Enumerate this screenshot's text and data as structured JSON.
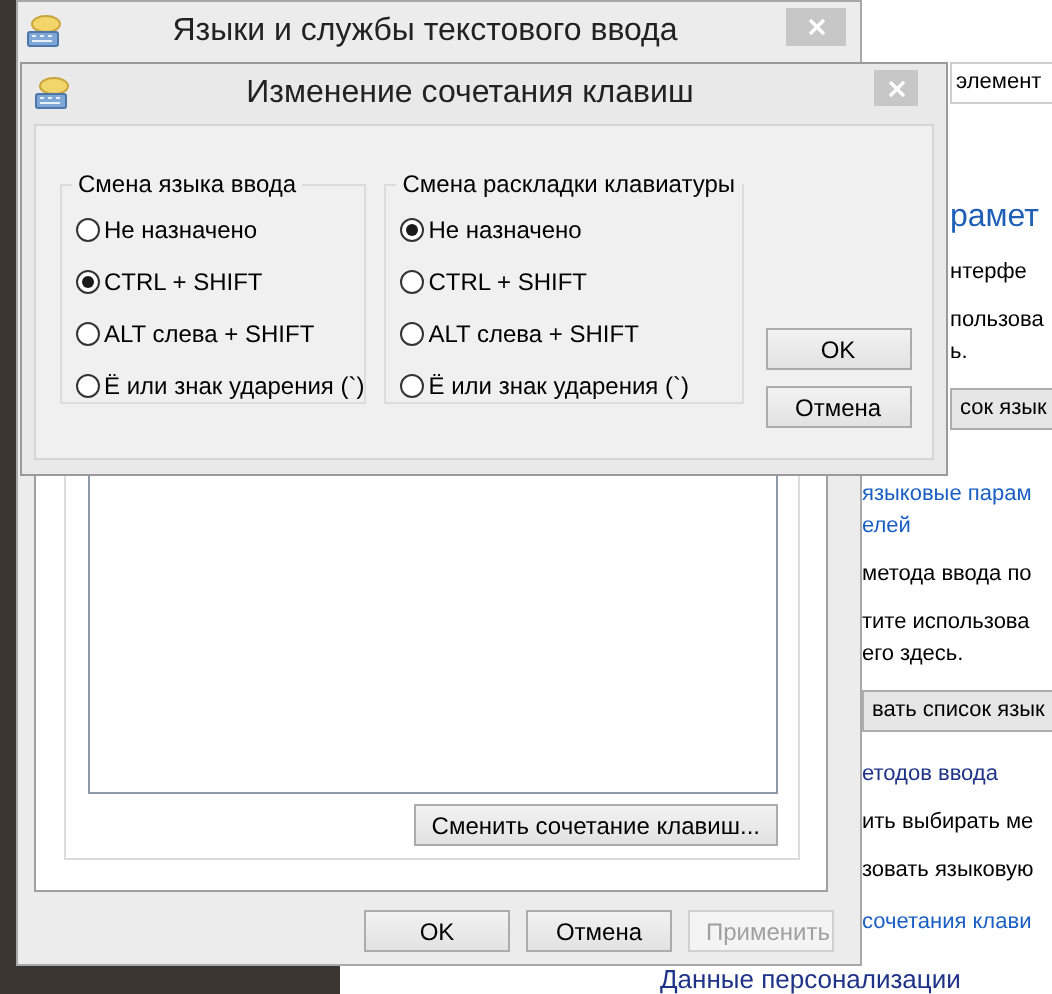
{
  "background": {
    "upper_items": [
      {
        "kind": "field",
        "lines": [
          "элемент"
        ]
      },
      {
        "kind": "heading",
        "lines": [
          "рамет"
        ]
      },
      {
        "kind": "text",
        "lines": [
          "нтерфе"
        ]
      },
      {
        "kind": "text",
        "lines": [
          "пользова",
          "ь."
        ]
      },
      {
        "kind": "button",
        "lines": [
          "сок язык"
        ]
      }
    ],
    "items": [
      {
        "kind": "link",
        "lines": [
          "языковые парам",
          "елей"
        ]
      },
      {
        "kind": "text",
        "lines": [
          "метода ввода по"
        ]
      },
      {
        "kind": "text",
        "lines": [
          "тите использова",
          "его здесь."
        ]
      },
      {
        "kind": "button",
        "lines": [
          "вать список язык"
        ]
      },
      {
        "kind": "section",
        "lines": [
          "етодов ввода"
        ]
      },
      {
        "kind": "text",
        "lines": [
          "ить выбирать ме"
        ]
      },
      {
        "kind": "text",
        "lines": [
          "зовать языковую"
        ]
      },
      {
        "kind": "link",
        "lines": [
          "сочетания клави"
        ]
      },
      {
        "kind": "footer",
        "lines": [
          "Данные персонализации"
        ]
      }
    ]
  },
  "main_window": {
    "title": "Языки и службы текстового ввода",
    "shortcut_button": "Сменить сочетание клавиш...",
    "buttons": [
      {
        "label": "OK",
        "disabled": false
      },
      {
        "label": "Отмена",
        "disabled": false
      },
      {
        "label": "Применить",
        "disabled": true
      }
    ]
  },
  "dialog": {
    "title": "Изменение сочетания клавиш",
    "groups": [
      {
        "title": "Смена языка ввода",
        "options": [
          {
            "label": "Не назначено",
            "selected": false
          },
          {
            "label": "CTRL + SHIFT",
            "selected": true
          },
          {
            "label": "ALT слева + SHIFT",
            "selected": false
          },
          {
            "label": "Ё или знак ударения (`)",
            "selected": false
          }
        ]
      },
      {
        "title": "Смена раскладки клавиатуры",
        "options": [
          {
            "label": "Не назначено",
            "selected": true
          },
          {
            "label": "CTRL + SHIFT",
            "selected": false
          },
          {
            "label": "ALT слева + SHIFT",
            "selected": false
          },
          {
            "label": "Ё или знак ударения (`)",
            "selected": false
          }
        ]
      }
    ],
    "buttons": [
      "OK",
      "Отмена"
    ]
  }
}
